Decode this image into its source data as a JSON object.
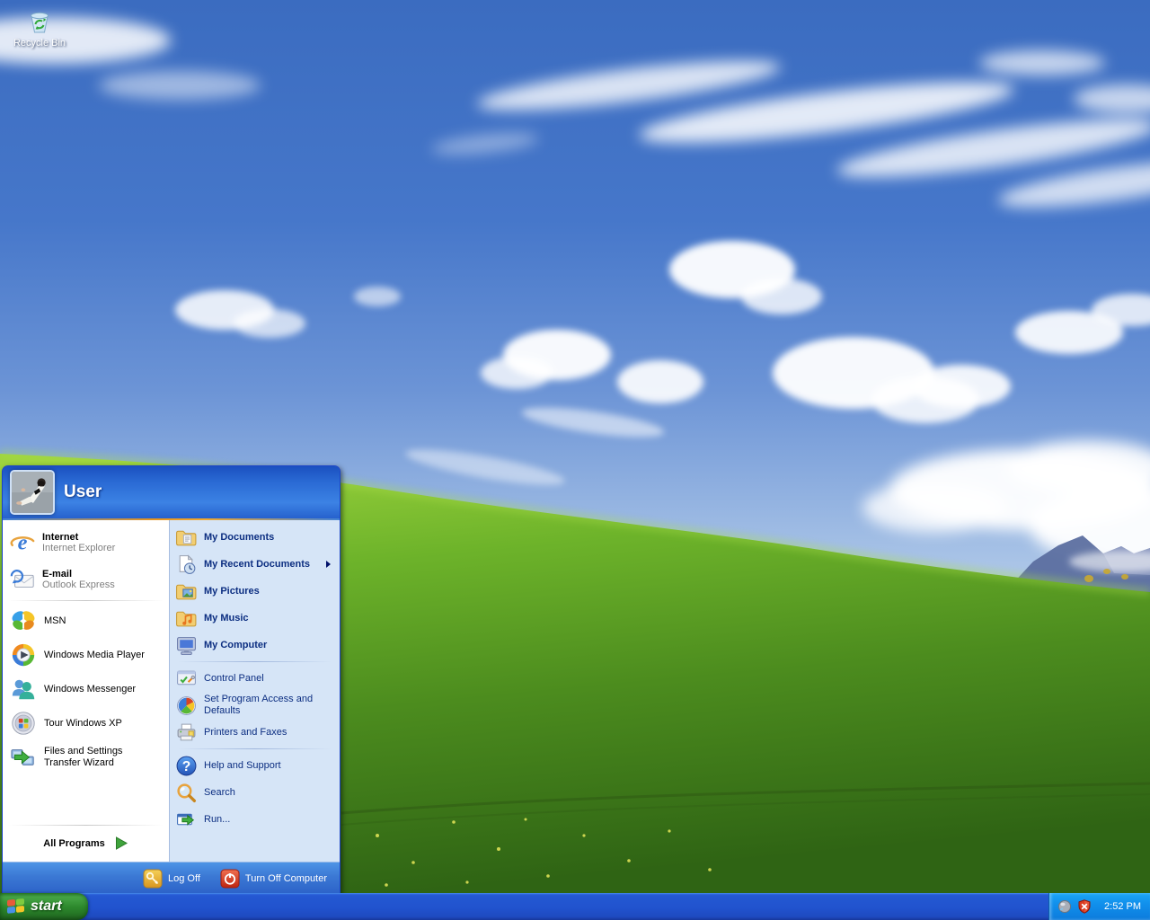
{
  "desktop": {
    "icons": [
      {
        "label": "Recycle Bin",
        "icon": "recycle-bin-icon"
      }
    ]
  },
  "start_menu": {
    "user_name": "User",
    "left_column": {
      "pinned": [
        {
          "title": "Internet",
          "subtitle": "Internet Explorer",
          "icon": "internet-explorer-icon"
        },
        {
          "title": "E-mail",
          "subtitle": "Outlook Express",
          "icon": "outlook-express-icon"
        }
      ],
      "items": [
        {
          "label": "MSN",
          "icon": "msn-icon"
        },
        {
          "label": "Windows Media Player",
          "icon": "windows-media-player-icon"
        },
        {
          "label": "Windows Messenger",
          "icon": "windows-messenger-icon"
        },
        {
          "label": "Tour Windows XP",
          "icon": "tour-windows-xp-icon"
        },
        {
          "label": "Files and Settings Transfer Wizard",
          "icon": "transfer-wizard-icon"
        }
      ],
      "all_programs_label": "All Programs"
    },
    "right_column": {
      "top_items": [
        {
          "label": "My Documents",
          "icon": "my-documents-icon"
        },
        {
          "label": "My Recent Documents",
          "icon": "my-recent-documents-icon",
          "has_submenu": true
        },
        {
          "label": "My Pictures",
          "icon": "my-pictures-icon"
        },
        {
          "label": "My Music",
          "icon": "my-music-icon"
        },
        {
          "label": "My Computer",
          "icon": "my-computer-icon"
        }
      ],
      "middle_items": [
        {
          "label": "Control Panel",
          "icon": "control-panel-icon"
        },
        {
          "label": "Set Program Access and Defaults",
          "icon": "program-access-icon"
        },
        {
          "label": "Printers and Faxes",
          "icon": "printers-faxes-icon"
        }
      ],
      "bottom_items": [
        {
          "label": "Help and Support",
          "icon": "help-support-icon"
        },
        {
          "label": "Search",
          "icon": "search-icon"
        },
        {
          "label": "Run...",
          "icon": "run-icon"
        }
      ]
    },
    "footer": {
      "log_off_label": "Log Off",
      "turn_off_label": "Turn Off Computer"
    }
  },
  "taskbar": {
    "start_label": "start",
    "tray": {
      "time": "2:52 PM",
      "icons": [
        "volume-ball-icon",
        "security-alert-shield-icon"
      ]
    }
  },
  "colors": {
    "taskbar_blue": "#2153CE",
    "tray_blue": "#1190EC",
    "start_button_green": "#2E8A2E",
    "menu_header_blue": "#2A6AD4",
    "menu_right_bg": "#D6E5F7",
    "menu_right_text": "#0C2E81",
    "orange_divider": "#E6941F",
    "grass_green": "#5CA024",
    "sky_blue": "#4677CA"
  }
}
